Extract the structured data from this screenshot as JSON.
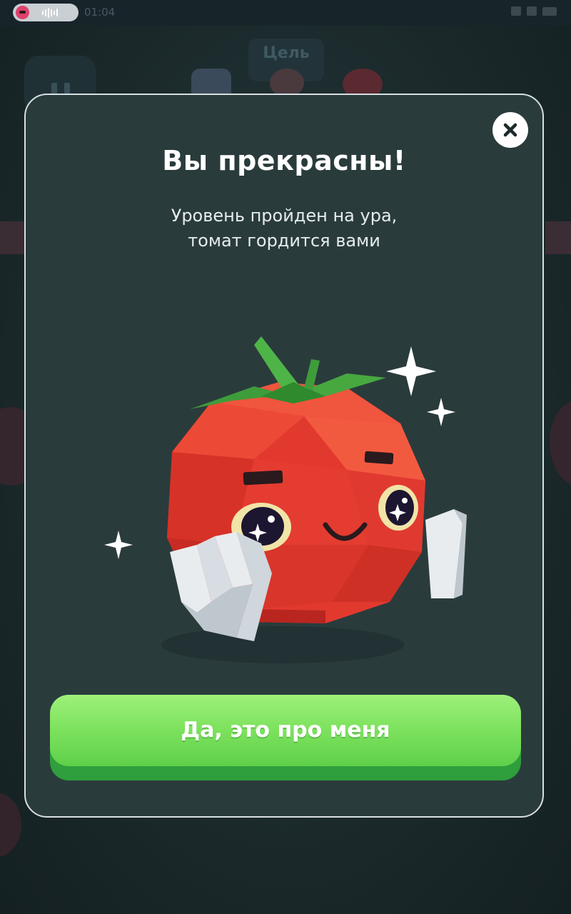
{
  "status_bar": {
    "time": "01:04"
  },
  "background": {
    "goal_label": "Цель"
  },
  "modal": {
    "title": "Вы прекрасны!",
    "subtitle_lines": [
      "Уровень пройден на ура,",
      "томат гордится вами"
    ],
    "close_icon": "close-icon",
    "mascot": "tomato-mascot",
    "confirm_button_label": "Да, это про меня"
  },
  "colors": {
    "modal_bg": "#2a3b3c",
    "modal_border": "#d8dfe3",
    "button_green": "#7fe35f",
    "button_green_dark": "#2f9e3c",
    "tomato_red": "#e2392f"
  }
}
